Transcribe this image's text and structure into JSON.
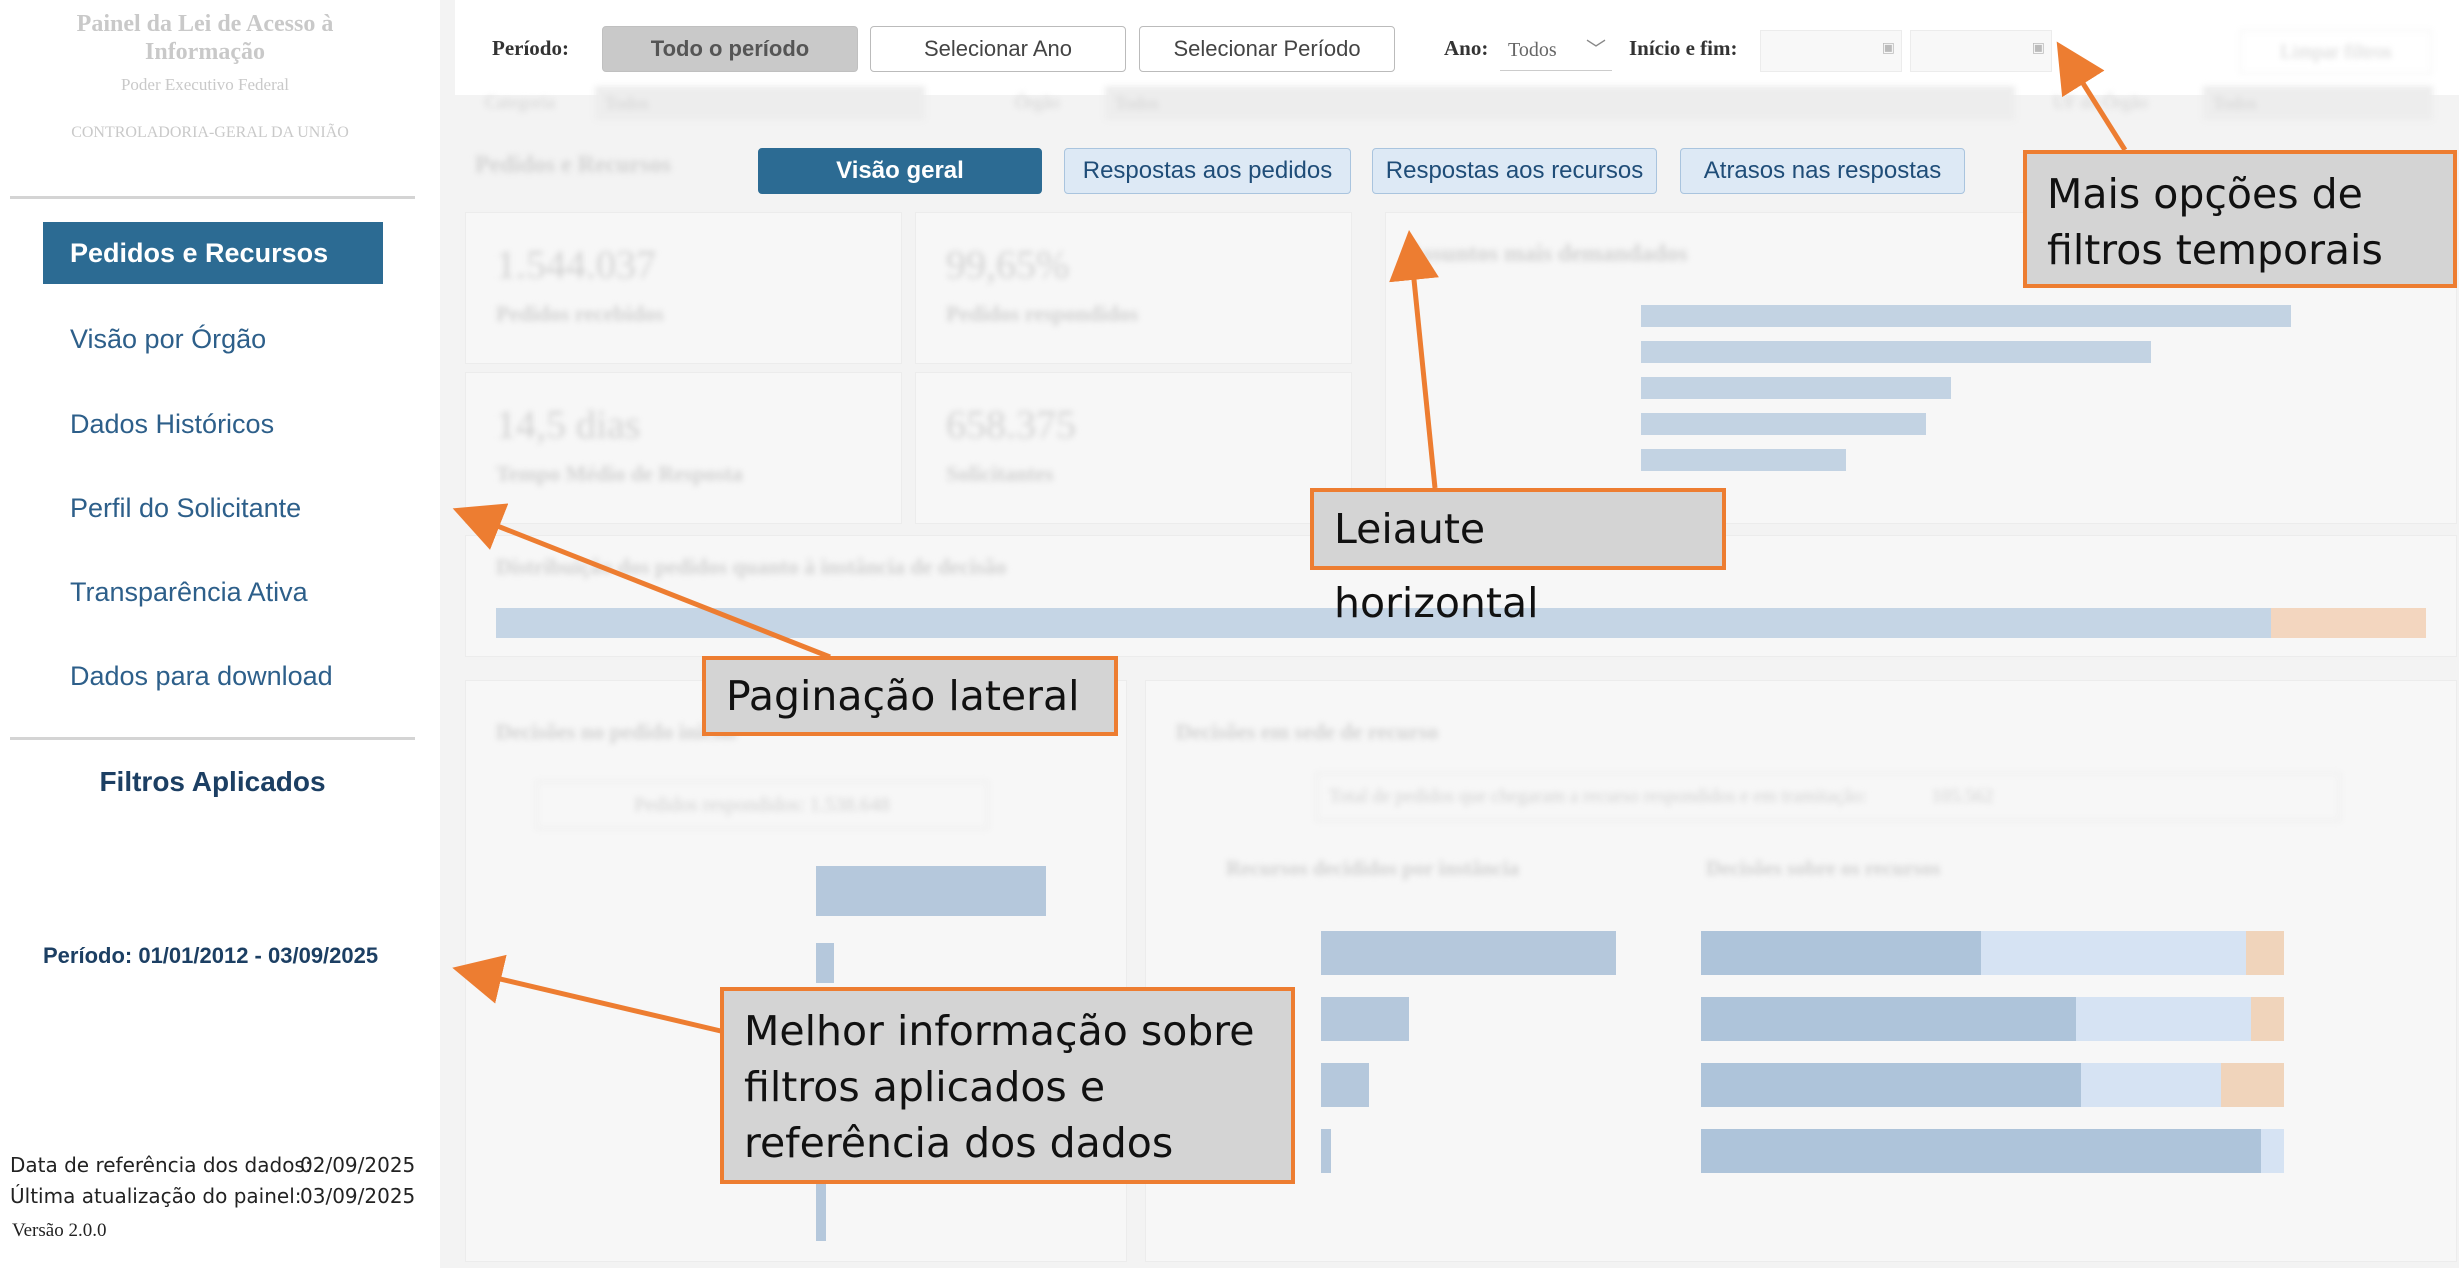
{
  "sidebar": {
    "title": "Painel da Lei de Acesso à Informação",
    "subtitle": "Poder Executivo Federal",
    "org": "CONTROLADORIA-GERAL DA UNIÃO",
    "items": [
      {
        "label": "Pedidos e Recursos",
        "active": true
      },
      {
        "label": "Visão por Órgão"
      },
      {
        "label": "Dados Históricos"
      },
      {
        "label": "Perfil do Solicitante"
      },
      {
        "label": "Transparência Ativa"
      },
      {
        "label": "Dados para download"
      }
    ],
    "filters_title": "Filtros Aplicados",
    "period_text": "Período: 01/01/2012 - 03/09/2025",
    "ref_label": "Data de referência dos dados:",
    "ref_value": "02/09/2025",
    "update_label": "Última atualização do painel:",
    "update_value": "03/09/2025",
    "version": "Versão 2.0.0"
  },
  "filters": {
    "period_label": "Período:",
    "btn_all": "Todo o período",
    "btn_year": "Selecionar Ano",
    "btn_period": "Selecionar Período",
    "year_label": "Ano:",
    "year_value": "Todos",
    "start_end_label": "Início e fim:",
    "clear_btn": "Limpar filtros",
    "category_label": "Categoria",
    "category_value": "Todos",
    "organ_label": "Órgão",
    "organ_value": "Todos",
    "extra_label": "UF do Órgão",
    "extra_value": "Todos"
  },
  "tabs": {
    "section_title": "Pedidos e Recursos",
    "items": [
      "Visão geral",
      "Respostas aos pedidos",
      "Respostas aos recursos",
      "Atrasos nas respostas"
    ]
  },
  "kpis": [
    {
      "value": "1.544.037",
      "label": "Pedidos recebidos"
    },
    {
      "value": "99,65%",
      "label": "Pedidos respondidos"
    },
    {
      "value": "14,5 dias",
      "label": "Tempo Médio de Resposta"
    },
    {
      "value": "658.375",
      "label": "Solicitantes"
    }
  ],
  "panels": {
    "topics_title": "Assuntos mais demandados",
    "distribution_title": "Distribuição dos pedidos quanto à instância de decisão",
    "decisions_title": "Decisões no pedido inicial",
    "decisions_answered": "Pedidos respondidos:",
    "decisions_answered_value": "1.538.648",
    "appeal_title": "Decisões em sede de recurso",
    "appeal_total": "Total de pedidos que chegaram a recurso respondidos e em tramitação:",
    "appeal_total_value": "105.562",
    "appeal_left_title": "Recursos decididos por instância",
    "appeal_right_title": "Decisões sobre os recursos"
  },
  "callouts": {
    "time_filters": "Mais opções de filtros temporais",
    "horizontal": "Leiaute horizontal",
    "side_pagination": "Paginação lateral",
    "filters_info": "Melhor informação sobre filtros aplicados e referência dos dados"
  },
  "colors": {
    "accent": "#2c6b93",
    "callout_border": "#ed7d31",
    "callout_bg": "#d4d4d4"
  }
}
